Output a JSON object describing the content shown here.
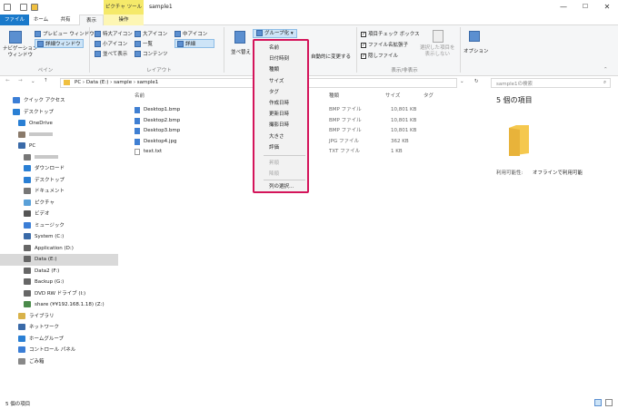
{
  "title": {
    "context_header": "ピクチャ ツール",
    "window_title": "sample1",
    "wc_min": "—",
    "wc_max": "☐",
    "wc_close": "✕"
  },
  "tabs": {
    "file": "ファイル",
    "home": "ホーム",
    "share": "共有",
    "view": "表示",
    "ops": "操作"
  },
  "ribbon": {
    "nav_pane": "ナビゲーション\nウィンドウ",
    "preview": "プレビュー ウィンドウ",
    "details_pane": "詳細ウィンドウ",
    "pane_group": "ペイン",
    "layout": [
      "特大アイコン",
      "大アイコン",
      "中アイコン",
      "小アイコン",
      "一覧",
      "詳細",
      "並べて表示",
      "コンテンツ"
    ],
    "layout_group": "レイアウト",
    "sort": "並べ替え",
    "group_by": "グループ化",
    "auto_fit": "自動的に変更する",
    "item_checkbox": "項目チェック ボックス",
    "file_ext": "ファイル名拡張子",
    "hidden": "隠しファイル",
    "hide_selected": "選択した項目を\n表示しない",
    "show_group": "表示/非表示",
    "options": "オプション"
  },
  "address": {
    "path": [
      "PC",
      "Data (E:)",
      "sample",
      "sample1"
    ],
    "search_placeholder": "sample1の検索"
  },
  "nav": [
    {
      "label": "クイック アクセス",
      "color": "#3b7ed6",
      "indent": 0
    },
    {
      "label": "デスクトップ",
      "color": "#2a7fd4",
      "indent": 0
    },
    {
      "label": "OneDrive",
      "color": "#2a7fd4",
      "indent": 1
    },
    {
      "label": "",
      "color": "#8a7a6a",
      "indent": 1
    },
    {
      "label": "PC",
      "color": "#3a6aa8",
      "indent": 1
    },
    {
      "label": "",
      "color": "#777",
      "indent": 2
    },
    {
      "label": "ダウンロード",
      "color": "#2a7fd4",
      "indent": 2
    },
    {
      "label": "デスクトップ",
      "color": "#2a7fd4",
      "indent": 2
    },
    {
      "label": "ドキュメント",
      "color": "#777",
      "indent": 2
    },
    {
      "label": "ピクチャ",
      "color": "#5aa0d8",
      "indent": 2
    },
    {
      "label": "ビデオ",
      "color": "#555",
      "indent": 2
    },
    {
      "label": "ミュージック",
      "color": "#3b7ed6",
      "indent": 2
    },
    {
      "label": "System (C:)",
      "color": "#3a6aa8",
      "indent": 2
    },
    {
      "label": "Application (D:)",
      "color": "#666",
      "indent": 2
    },
    {
      "label": "Data (E:)",
      "color": "#666",
      "indent": 2
    },
    {
      "label": "Data2 (F:)",
      "color": "#666",
      "indent": 2
    },
    {
      "label": "Backup (G:)",
      "color": "#666",
      "indent": 2
    },
    {
      "label": "DVD RW ドライブ (I:)",
      "color": "#666",
      "indent": 2
    },
    {
      "label": "share (¥¥192.168.1.18) (Z:)",
      "color": "#4a8a4a",
      "indent": 2
    },
    {
      "label": "ライブラリ",
      "color": "#d8b24a",
      "indent": 1
    },
    {
      "label": "ネットワーク",
      "color": "#3a6aa8",
      "indent": 1
    },
    {
      "label": "ホームグループ",
      "color": "#2a7fd4",
      "indent": 1
    },
    {
      "label": "コントロール パネル",
      "color": "#3b7ed6",
      "indent": 1
    },
    {
      "label": "ごみ箱",
      "color": "#888",
      "indent": 1
    }
  ],
  "columns": {
    "name": "名前",
    "type": "種類",
    "size": "サイズ",
    "tag": "タグ"
  },
  "files": [
    {
      "name": "Desktop1.bmp",
      "type": "BMP ファイル",
      "size": "10,801 KB"
    },
    {
      "name": "Desktop2.bmp",
      "type": "BMP ファイル",
      "size": "10,801 KB"
    },
    {
      "name": "Desktop3.bmp",
      "type": "BMP ファイル",
      "size": "10,801 KB"
    },
    {
      "name": "Desktop4.jpg",
      "type": "JPG ファイル",
      "size": "362 KB"
    },
    {
      "name": "text.txt",
      "type": "TXT ファイル",
      "size": "1 KB"
    }
  ],
  "menu": {
    "items": [
      "名前",
      "日付時刻",
      "種類",
      "サイズ",
      "タグ",
      "作成日時",
      "更新日時",
      "撮影日時",
      "大きさ",
      "評価"
    ],
    "disabled": [
      "昇順",
      "降順"
    ],
    "choose": "列の選択..."
  },
  "details": {
    "count": "5 個の項目",
    "avail_label": "利用可能性:",
    "avail_value": "オフラインで利用可能"
  },
  "status": "5 個の項目"
}
